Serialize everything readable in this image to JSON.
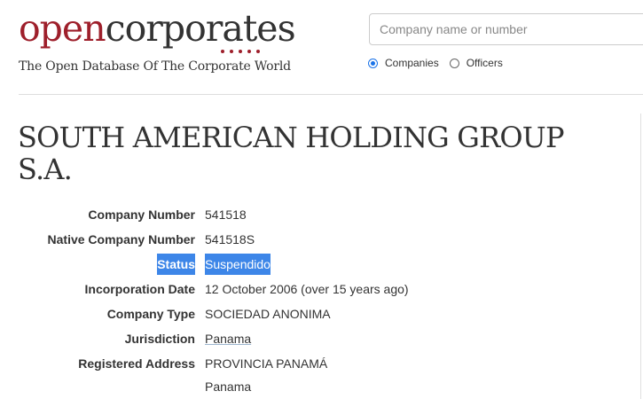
{
  "brand": {
    "logo_part1": "open",
    "logo_part2": "corporates",
    "tagline": "The Open Database Of The Corporate World",
    "colors": {
      "brand_red": "#9e1f2b",
      "text": "#333333",
      "link": "#1d4e78",
      "selection": "#3d86e8"
    }
  },
  "search": {
    "placeholder": "Company name or number",
    "options": [
      {
        "label": "Companies",
        "selected": true
      },
      {
        "label": "Officers",
        "selected": false
      }
    ]
  },
  "company": {
    "name": "SOUTH AMERICAN HOLDING GROUP S.A.",
    "attributes": [
      {
        "key": "Company Number",
        "value": "541518"
      },
      {
        "key": "Native Company Number",
        "value": "541518S"
      },
      {
        "key": "Status",
        "value": "Suspendido",
        "highlighted": true
      },
      {
        "key": "Incorporation Date",
        "value": "12 October 2006 (over 15 years ago)"
      },
      {
        "key": "Company Type",
        "value": "SOCIEDAD ANONIMA"
      },
      {
        "key": "Jurisdiction",
        "value": "Panama",
        "link": true
      },
      {
        "key": "Registered Address",
        "value": "PROVINCIA PANAMÁ",
        "value_line2": "Panama"
      }
    ]
  }
}
